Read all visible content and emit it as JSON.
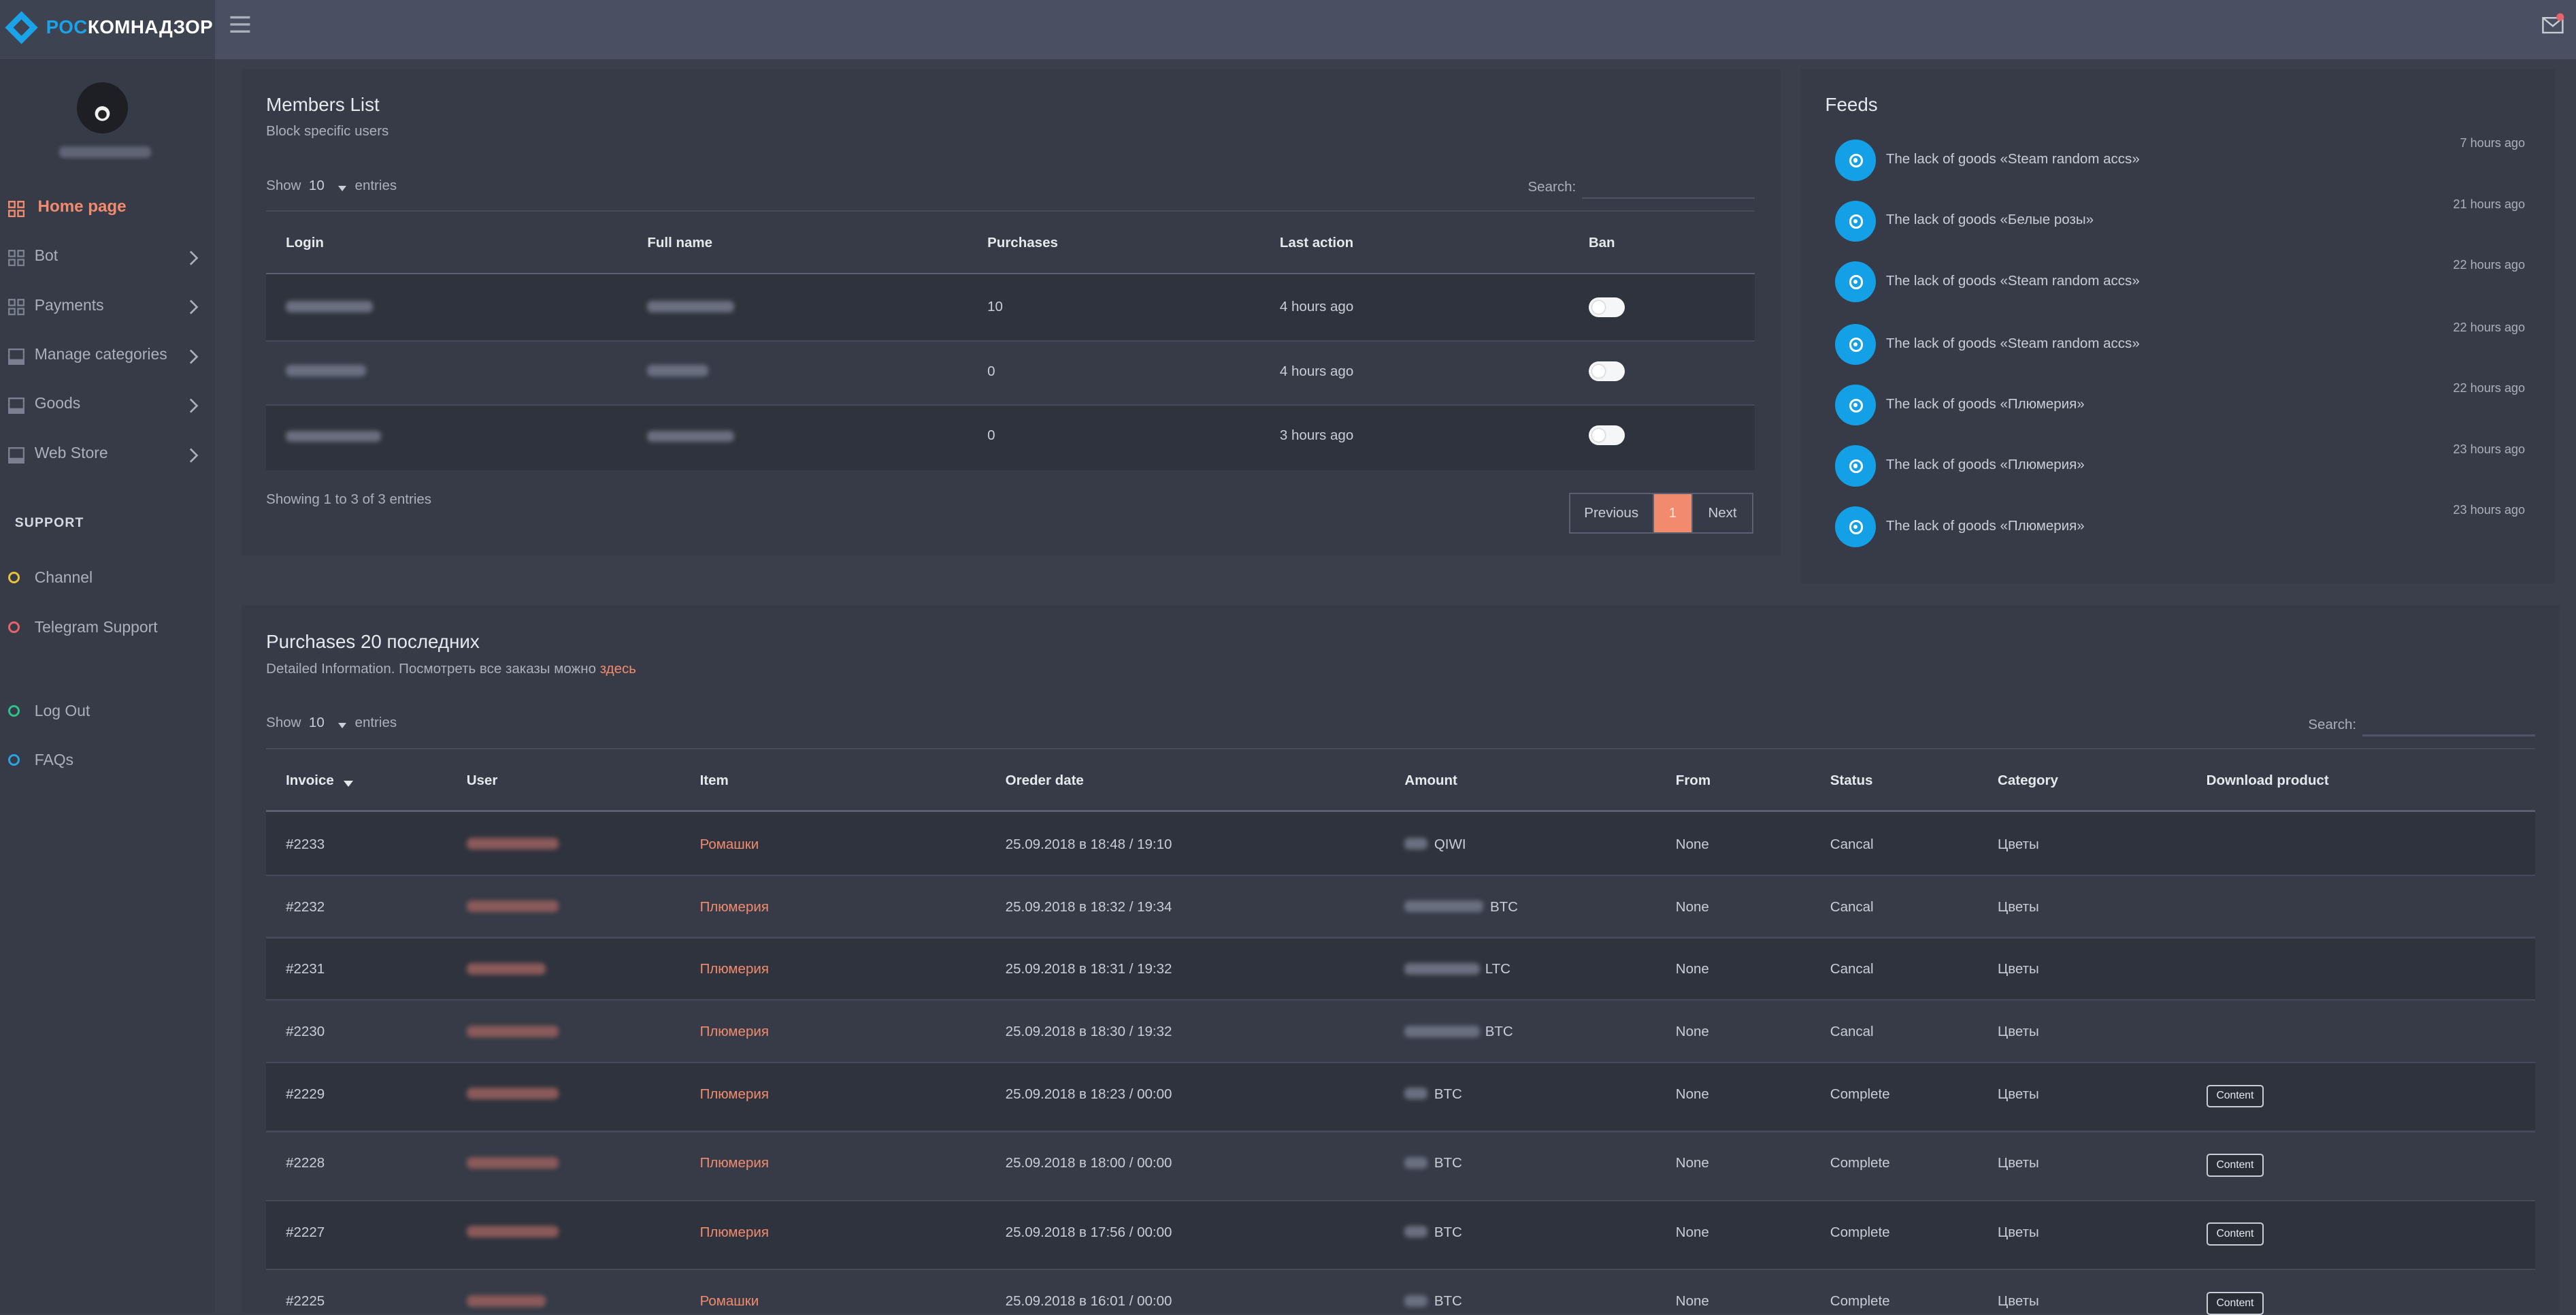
{
  "brand": {
    "name_part1": "РОС",
    "name_part2": "КОМНАДЗОР",
    "accent": "#1aa3e8"
  },
  "header": {
    "menu_icon": "hamburger-icon",
    "mail_icon": "mail-icon"
  },
  "sidebar": {
    "items": [
      {
        "label": "Home page",
        "icon": "grid-icon",
        "active": true
      },
      {
        "label": "Bot",
        "icon": "grid-icon"
      },
      {
        "label": "Payments",
        "icon": "grid-icon"
      },
      {
        "label": "Manage categories",
        "icon": "panel-icon"
      },
      {
        "label": "Goods",
        "icon": "panel-icon"
      },
      {
        "label": "Web Store",
        "icon": "panel-icon"
      }
    ],
    "support_title": "SUPPORT",
    "support_items": [
      {
        "label": "Channel",
        "color": "#e8c23a"
      },
      {
        "label": "Telegram Support",
        "color": "#e8626b"
      }
    ],
    "bottom_items": [
      {
        "label": "Log Out",
        "color": "#2ec38a"
      },
      {
        "label": "FAQs",
        "color": "#2ba3e0"
      }
    ]
  },
  "members": {
    "title": "Members List",
    "subtitle": "Block specific users",
    "show_label": "Show",
    "show_value": "10",
    "entries_label": "entries",
    "search_label": "Search:",
    "columns": [
      "Login",
      "Full name",
      "Purchases",
      "Last action",
      "Ban"
    ],
    "rows": [
      {
        "purchases": "10",
        "last_action": "4 hours ago"
      },
      {
        "purchases": "0",
        "last_action": "4 hours ago"
      },
      {
        "purchases": "0",
        "last_action": "3 hours ago"
      }
    ],
    "showing": "Showing 1 to 3 of 3 entries",
    "pager": {
      "prev": "Previous",
      "current": "1",
      "next": "Next"
    }
  },
  "feeds": {
    "title": "Feeds",
    "items": [
      {
        "text": "The lack of goods «Steam random accs»",
        "time": "7 hours ago"
      },
      {
        "text": "The lack of goods «Белые розы»",
        "time": "21 hours ago"
      },
      {
        "text": "The lack of goods «Steam random accs»",
        "time": "22 hours ago"
      },
      {
        "text": "The lack of goods «Steam random accs»",
        "time": "22 hours ago"
      },
      {
        "text": "The lack of goods «Плюмерия»",
        "time": "22 hours ago"
      },
      {
        "text": "The lack of goods «Плюмерия»",
        "time": "23 hours ago"
      },
      {
        "text": "The lack of goods «Плюмерия»",
        "time": "23 hours ago"
      }
    ]
  },
  "purchases": {
    "title": "Purchases 20 последних",
    "subtitle": "Detailed Information. Посмотреть все заказы можно",
    "subtitle_link": "здесь",
    "show_label": "Show",
    "show_value": "10",
    "entries_label": "entries",
    "search_label": "Search:",
    "columns": [
      "Invoice",
      "User",
      "Item",
      "Oreder date",
      "Amount",
      "From",
      "Status",
      "Category",
      "Download product"
    ],
    "rows": [
      {
        "invoice": "#2233",
        "item": "Ромашки",
        "date": "25.09.2018 в 18:48 / 19:10",
        "currency": "QIWI",
        "from": "None",
        "status": "Cancal",
        "category": "Цветы",
        "download": ""
      },
      {
        "invoice": "#2232",
        "item": "Плюмерия",
        "date": "25.09.2018 в 18:32 / 19:34",
        "currency": "BTC",
        "from": "None",
        "status": "Cancal",
        "category": "Цветы",
        "download": ""
      },
      {
        "invoice": "#2231",
        "item": "Плюмерия",
        "date": "25.09.2018 в 18:31 / 19:32",
        "currency": "LTC",
        "from": "None",
        "status": "Cancal",
        "category": "Цветы",
        "download": ""
      },
      {
        "invoice": "#2230",
        "item": "Плюмерия",
        "date": "25.09.2018 в 18:30 / 19:32",
        "currency": "BTC",
        "from": "None",
        "status": "Cancal",
        "category": "Цветы",
        "download": ""
      },
      {
        "invoice": "#2229",
        "item": "Плюмерия",
        "date": "25.09.2018 в 18:23 / 00:00",
        "currency": "BTC",
        "from": "None",
        "status": "Complete",
        "category": "Цветы",
        "download": "Content"
      },
      {
        "invoice": "#2228",
        "item": "Плюмерия",
        "date": "25.09.2018 в 18:00 / 00:00",
        "currency": "BTC",
        "from": "None",
        "status": "Complete",
        "category": "Цветы",
        "download": "Content"
      },
      {
        "invoice": "#2227",
        "item": "Плюмерия",
        "date": "25.09.2018 в 17:56 / 00:00",
        "currency": "BTC",
        "from": "None",
        "status": "Complete",
        "category": "Цветы",
        "download": "Content"
      },
      {
        "invoice": "#2225",
        "item": "Ромашки",
        "date": "25.09.2018 в 16:01 / 00:00",
        "currency": "BTC",
        "from": "None",
        "status": "Complete",
        "category": "Цветы",
        "download": "Content"
      }
    ]
  },
  "colors": {
    "accent": "#f28b6e",
    "feed_icon": "#14a0e6",
    "background": "#3a3f4b",
    "card": "#363b47"
  }
}
